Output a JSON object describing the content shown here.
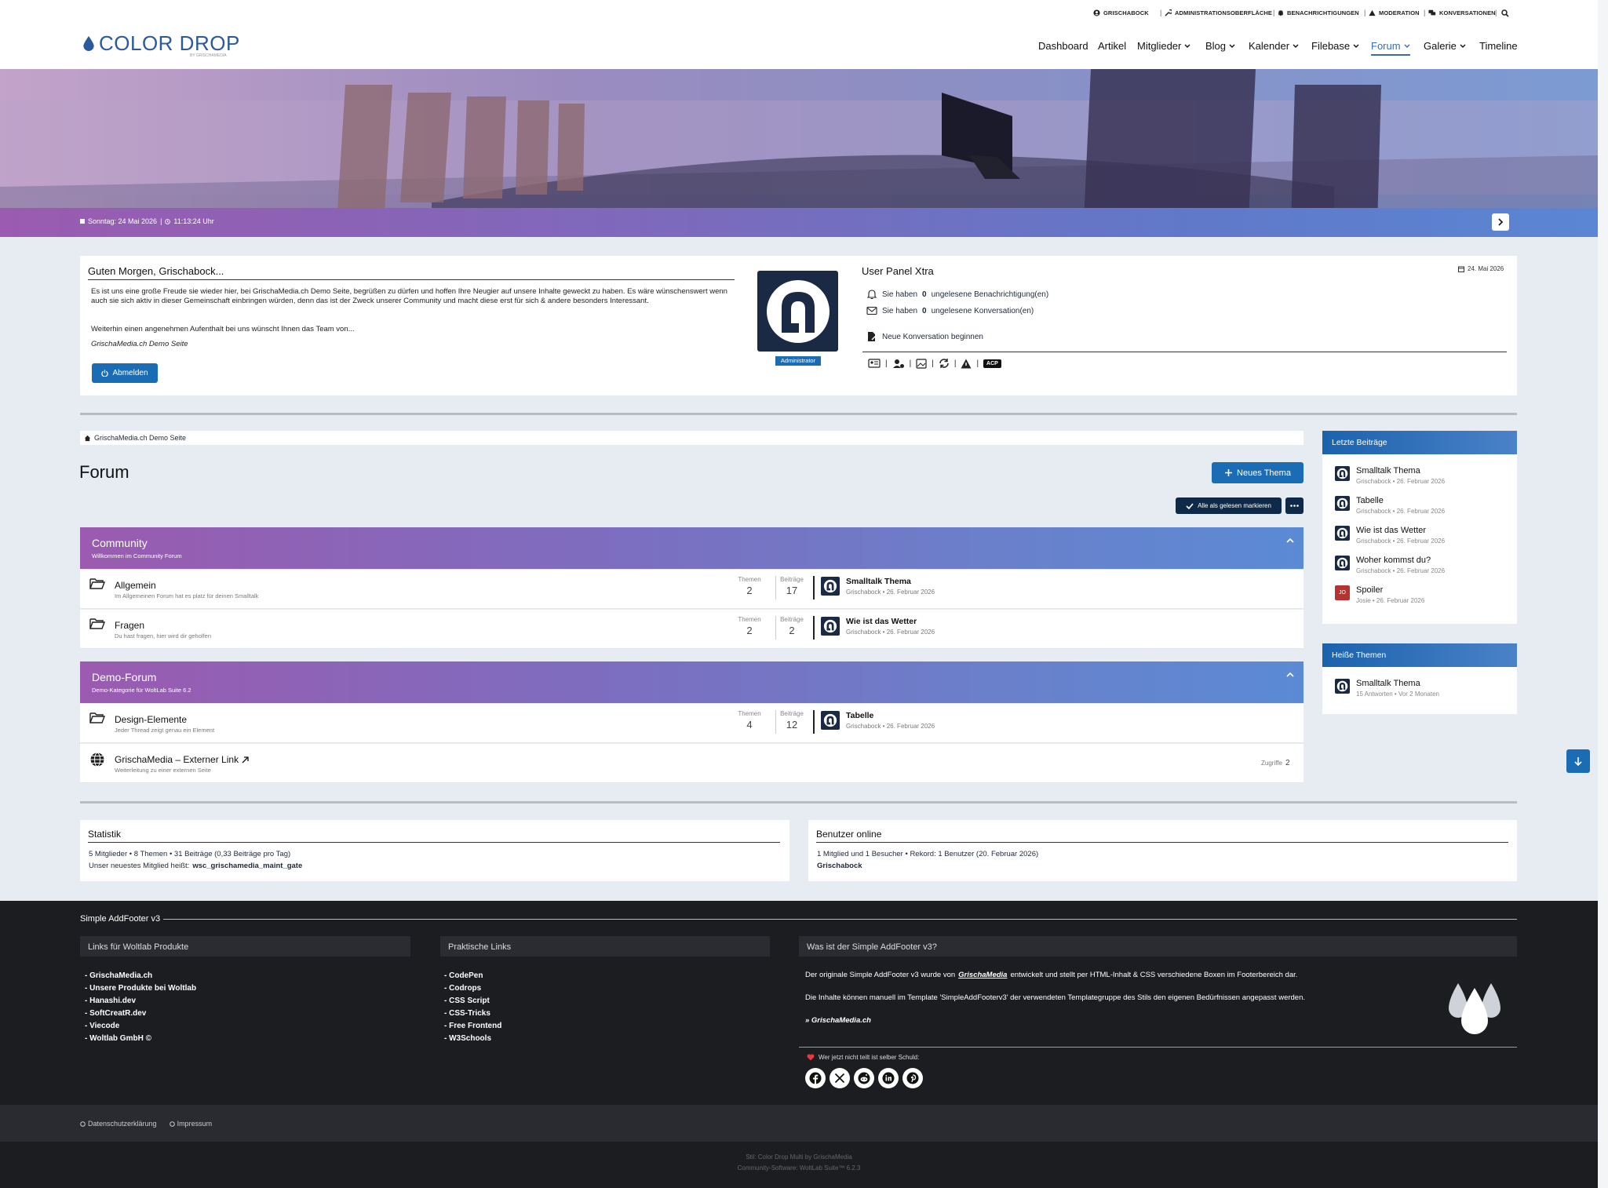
{
  "topbar": {
    "links": [
      "GRISCHABOCK",
      "ADMINISTRATIONSOBERFLÄCHE",
      "BENACHRICHTIGUNGEN",
      "MODERATION",
      "KONVERSATIONEN"
    ]
  },
  "brand": {
    "name": "COLOR DROP",
    "sub": "BY GRISCHAMEDIA"
  },
  "nav": {
    "items": [
      "Dashboard",
      "Artikel",
      "Mitglieder",
      "Blog",
      "Kalender",
      "Filebase",
      "Forum",
      "Galerie",
      "Timeline"
    ],
    "active": "Forum"
  },
  "hero": {
    "date": "Sonntag: 24 Mai 2026",
    "time": "11:13:24 Uhr"
  },
  "welcome": {
    "title": "Guten Morgen, Grischabock...",
    "p1": "Es ist uns eine große Freude sie wieder hier, bei GrischaMedia.ch Demo Seite, begrüßen zu dürfen und hoffen Ihre Neugier auf unsere Inhalte geweckt zu haben. Es wäre wünschenswert wenn auch sie sich aktiv in dieser Gemeinschaft einbringen würden, denn das ist der Zweck unserer Community und macht diese erst für sich & andere besonders Interessant.",
    "p2": "Weiterhin einen angenehmen Aufenthalt bei uns wünscht Ihnen das Team von...",
    "site": "GrischaMedia.ch Demo Seite",
    "logout": "Abmelden",
    "role": "Administrator"
  },
  "userpanel": {
    "title": "User Panel Xtra",
    "date": "24. Mai 2026",
    "notif_pre": "Sie haben",
    "notif_count": "0",
    "notif_post": "ungelesene Benachrichtigung(en)",
    "conv_pre": "Sie haben",
    "conv_count": "0",
    "conv_post": "ungelesene Konversation(en)",
    "new_conv": "Neue Konversation beginnen",
    "acp": "ACP"
  },
  "breadcrumb": "GrischaMedia.ch Demo Seite",
  "page_title": "Forum",
  "buttons": {
    "new_thread": "Neues Thema",
    "mark_read": "Alle als gelesen markieren"
  },
  "categories": [
    {
      "title": "Community",
      "desc": "Willkommen im Community Forum",
      "boards": [
        {
          "name": "Allgemein",
          "desc": "Im Allgemeinen Forum hat es platz für deinen Smalltalk",
          "threads_label": "Themen",
          "threads": "2",
          "posts_label": "Beiträge",
          "posts": "17",
          "last_title": "Smalltalk Thema",
          "last_meta": "Grischabock • 26. Februar 2026"
        },
        {
          "name": "Fragen",
          "desc": "Du hast fragen, hier wird dir geholfen",
          "threads_label": "Themen",
          "threads": "2",
          "posts_label": "Beiträge",
          "posts": "2",
          "last_title": "Wie ist das Wetter",
          "last_meta": "Grischabock • 26. Februar 2026"
        }
      ]
    },
    {
      "title": "Demo-Forum",
      "desc": "Demo-Kategorie für WoltLab Suite 6.2",
      "boards": [
        {
          "name": "Design-Elemente",
          "desc": "Jeder Thread zeigt genau ein Element",
          "threads_label": "Themen",
          "threads": "4",
          "posts_label": "Beiträge",
          "posts": "12",
          "last_title": "Tabelle",
          "last_meta": "Grischabock • 26. Februar 2026"
        }
      ],
      "link": {
        "name": "GrischaMedia – Externer Link",
        "desc": "Weiterleitung zu einer externen Seite",
        "hits_label": "Zugriffe",
        "hits": "2"
      }
    }
  ],
  "sidebar": {
    "latest_title": "Letzte Beiträge",
    "latest": [
      {
        "title": "Smalltalk Thema",
        "meta": "Grischabock • 26. Februar 2026",
        "avatar": "logo"
      },
      {
        "title": "Tabelle",
        "meta": "Grischabock • 26. Februar 2026",
        "avatar": "logo"
      },
      {
        "title": "Wie ist das Wetter",
        "meta": "Grischabock • 26. Februar 2026",
        "avatar": "logo"
      },
      {
        "title": "Woher kommst du?",
        "meta": "Grischabock • 26. Februar 2026",
        "avatar": "logo"
      },
      {
        "title": "Spoiler",
        "meta": "Josie • 26. Februar 2026",
        "avatar": "JO"
      }
    ],
    "hot_title": "Heiße Themen",
    "hot": [
      {
        "title": "Smalltalk Thema",
        "meta": "15 Antworten • Vor 2 Monaten"
      }
    ]
  },
  "stats": {
    "title": "Statistik",
    "line1": "5 Mitglieder • 8 Themen • 31 Beiträge (0,33 Beiträge pro Tag)",
    "line2_pre": "Unser neuestes Mitglied heißt:",
    "line2_user": "wsc_grischamedia_maint_gate"
  },
  "online": {
    "title": "Benutzer online",
    "line1": "1 Mitglied und 1 Besucher • Rekord: 1 Benutzer (20. Februar 2026)",
    "user": "Grischabock"
  },
  "footer": {
    "title": "Simple AddFooter v3",
    "col1_title": "Links für Woltlab Produkte",
    "col1": [
      "GrischaMedia.ch",
      "Unsere Produkte bei Woltlab",
      "Hanashi.dev",
      "SoftCreatR.dev",
      "Viecode",
      "Woltlab GmbH ©"
    ],
    "col2_title": "Praktische Links",
    "col2": [
      "CodePen",
      "Codrops",
      "CSS Script",
      "CSS-Tricks",
      "Free Frontend",
      "W3Schools"
    ],
    "col3_title": "Was ist der Simple AddFooter v3?",
    "col3_p1_pre": "Der originale Simple AddFooter v3 wurde von",
    "col3_p1_brand": "GrischaMedia",
    "col3_p1_post": "entwickelt und stellt per HTML-Inhalt & CSS verschiedene Boxen im Footerbereich dar.",
    "col3_p2": "Die Inhalte können manuell im Template 'SimpleAddFooterv3' der verwendeten Templategruppe des Stils den eigenen Bedürfnissen angepasst werden.",
    "col3_link": "» GrischaMedia.ch",
    "share": "Wer jetzt nicht teilt ist selber Schuld:",
    "legal": [
      "Datenschutzerklärung",
      "Impressum"
    ],
    "credit1": "Stil: Color Drop Multi by GrischaMedia",
    "credit2": "Community-Software: WoltLab Suite™ 6.2.3"
  },
  "colors": {
    "accent": "#1a6cb5",
    "navy": "#1b2a44",
    "gradient_start": "#9a5bb0",
    "gradient_end": "#5b8ad5",
    "footer": "#1c1d21"
  }
}
